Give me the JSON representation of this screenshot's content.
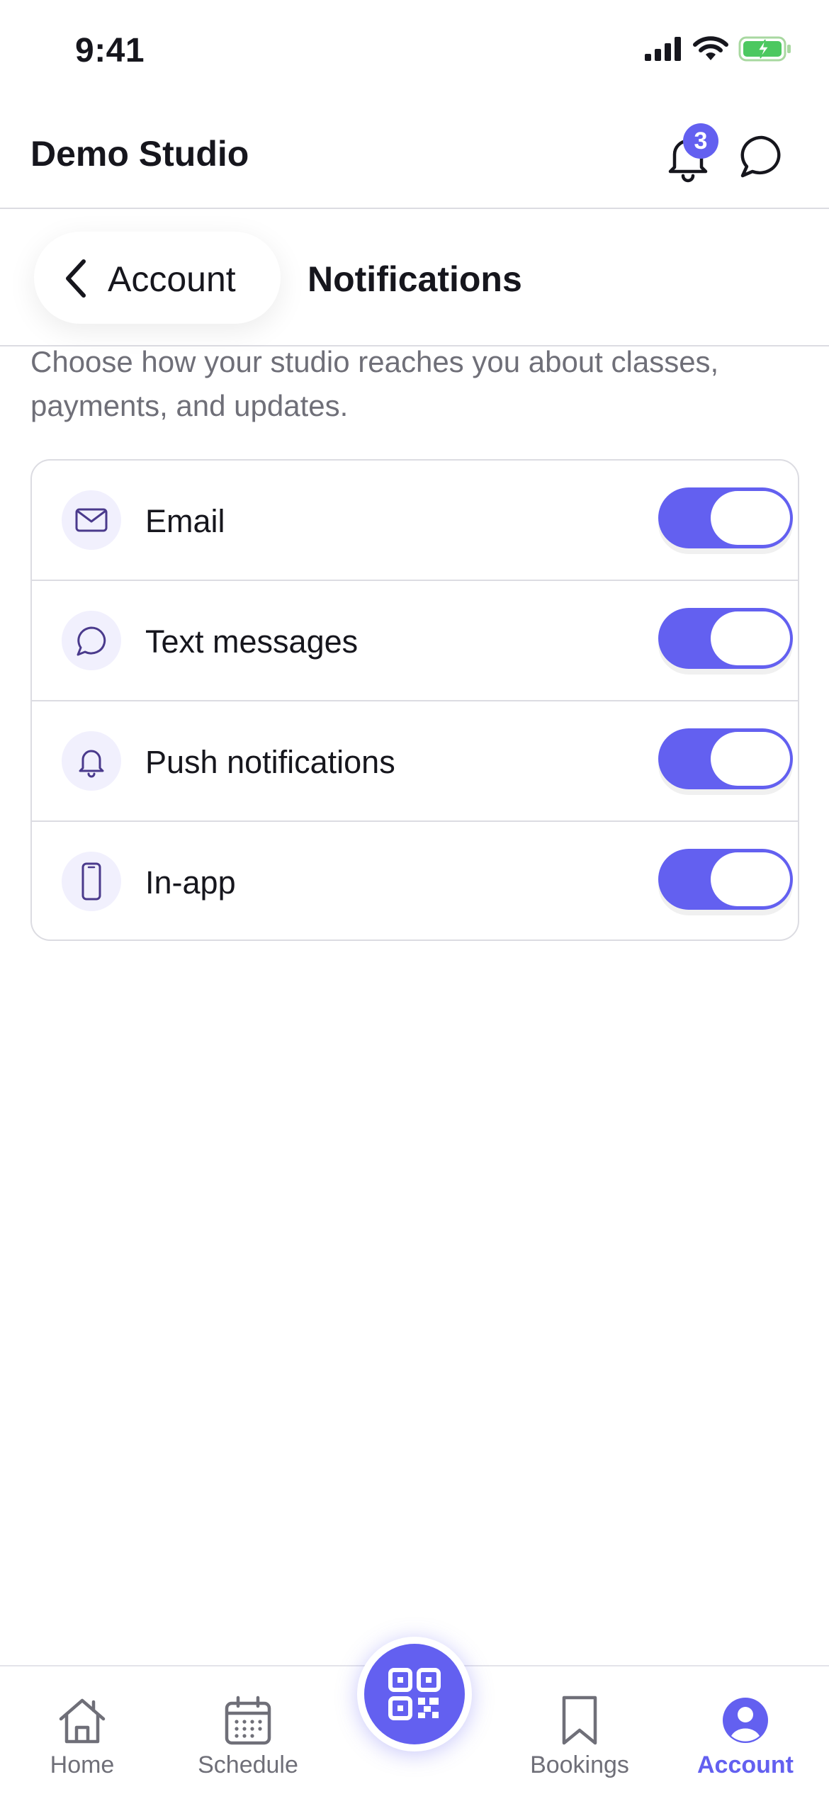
{
  "status_bar": {
    "time": "9:41"
  },
  "app_bar": {
    "title": "Demo Studio",
    "notification_count": "3"
  },
  "header": {
    "back_label": "Account",
    "title": "Notifications"
  },
  "description": "Choose how your studio reaches you about classes, payments, and updates.",
  "settings": [
    {
      "label": "Email",
      "icon": "mail-icon",
      "enabled": true
    },
    {
      "label": "Text messages",
      "icon": "message-bubble-icon",
      "enabled": true
    },
    {
      "label": "Push notifications",
      "icon": "bell-icon",
      "enabled": true
    },
    {
      "label": "In-app",
      "icon": "phone-icon",
      "enabled": true
    }
  ],
  "tab_bar": {
    "items": [
      {
        "label": "Home",
        "icon": "home-icon"
      },
      {
        "label": "Schedule",
        "icon": "calendar-icon"
      },
      {
        "label": "Bookings",
        "icon": "bookmark-icon"
      },
      {
        "label": "Account",
        "icon": "user-circle-icon",
        "active": true
      }
    ],
    "center_action": "qr-code-icon"
  },
  "colors": {
    "accent": "#6360f0",
    "text": "#16161d",
    "muted": "#6f6f78",
    "divider": "#dcdce2"
  }
}
